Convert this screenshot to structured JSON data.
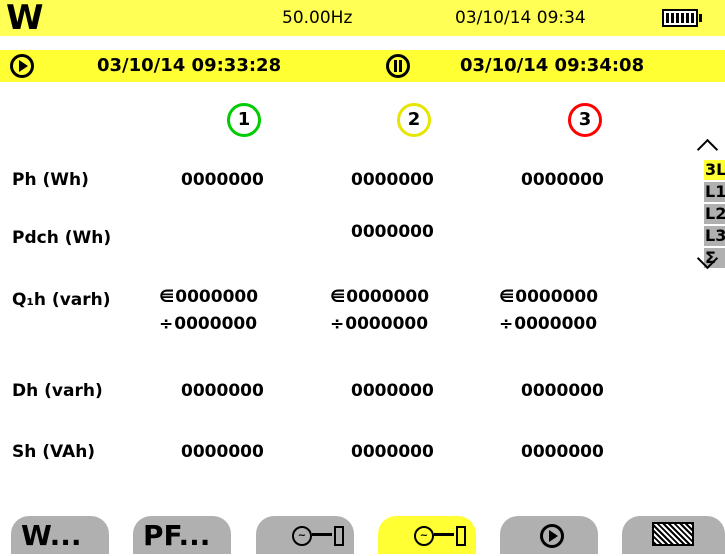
{
  "status_bar": {
    "logo": "W",
    "frequency": "50.00Hz",
    "datetime": "03/10/14 09:34",
    "battery_icon": "battery-icon"
  },
  "recording": {
    "start": "03/10/14  09:33:28",
    "end": "03/10/14  09:34:08"
  },
  "phases": [
    {
      "label": "1",
      "color": "#00cc00"
    },
    {
      "label": "2",
      "color": "#e6e600"
    },
    {
      "label": "3",
      "color": "#ff0000"
    }
  ],
  "rows": [
    {
      "label": "Ph (Wh)",
      "values": [
        "0000000",
        "0000000",
        "0000000"
      ]
    },
    {
      "label": "Pdch (Wh)",
      "values": [
        "",
        "0000000",
        ""
      ]
    },
    {
      "label": "Q₁h (varh)",
      "values_cap": [
        "0000000",
        "0000000",
        "0000000"
      ],
      "values_ind": [
        "0000000",
        "0000000",
        "0000000"
      ]
    },
    {
      "label": "Dh (varh)",
      "values": [
        "0000000",
        "0000000",
        "0000000"
      ]
    },
    {
      "label": "Sh (VAh)",
      "values": [
        "0000000",
        "0000000",
        "0000000"
      ]
    }
  ],
  "side_tabs": [
    "3L",
    "L1",
    "L2",
    "L3",
    "Σ"
  ],
  "bottom_tabs": {
    "w": "W...",
    "pf": "PF..."
  }
}
